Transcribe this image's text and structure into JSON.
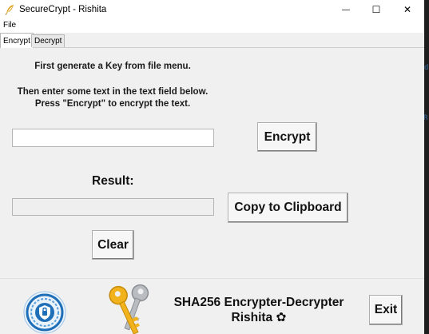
{
  "window": {
    "title": "SecureCrypt - Rishita",
    "controls": {
      "minimize": "—",
      "maximize": "☐",
      "close": "✕"
    }
  },
  "menu": {
    "file": "File"
  },
  "tabs": [
    {
      "label": "Encrypt",
      "active": true
    },
    {
      "label": "Decrypt",
      "active": false
    }
  ],
  "encrypt_tab": {
    "instruction_line1": "First generate a Key from file menu.",
    "instruction_line2": "Then enter some text in the text field below.",
    "instruction_line3": "Press \"Encrypt\" to encrypt the text.",
    "input_value": "",
    "encrypt_button": "Encrypt",
    "result_label": "Result:",
    "result_value": "",
    "copy_button": "Copy to Clipboard",
    "clear_button": "Clear"
  },
  "footer": {
    "title_line1": "SHA256 Encrypter-Decrypter",
    "title_line2": "Rishita ✿",
    "exit_button": "Exit"
  },
  "background_glyphs": {
    "top": "d\"",
    "middle": "R:"
  },
  "colors": {
    "window_bg": "#f0f0f0",
    "key_gold": "#f2b21b",
    "key_silver": "#b9bcc0",
    "seal_blue": "#1f6fb8"
  }
}
